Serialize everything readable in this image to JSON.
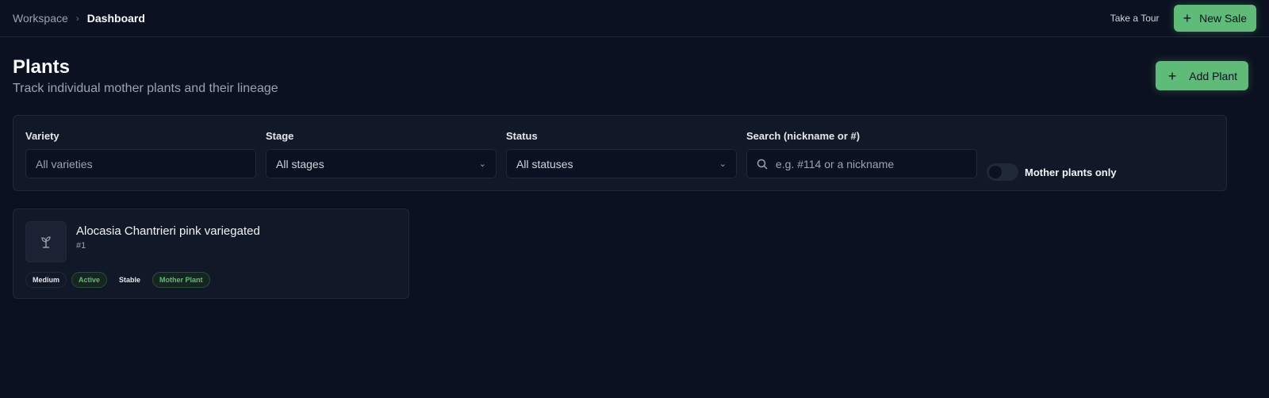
{
  "breadcrumb": {
    "workspace": "Workspace",
    "separator": "›",
    "current": "Dashboard"
  },
  "header": {
    "tour_label": "Take a Tour",
    "new_sale_label": "New Sale"
  },
  "page": {
    "title": "Plants",
    "subtitle": "Track individual mother plants and their lineage",
    "add_label": "Add Plant"
  },
  "filters": {
    "variety": {
      "label": "Variety",
      "placeholder": "All varieties"
    },
    "stage": {
      "label": "Stage",
      "value": "All stages"
    },
    "status": {
      "label": "Status",
      "value": "All statuses"
    },
    "search": {
      "label": "Search (nickname or #)",
      "placeholder": "e.g. #114 or a nickname"
    },
    "mother_toggle": {
      "label": "Mother plants only",
      "on": false
    }
  },
  "plants": [
    {
      "name": "Alocasia Chantrieri pink variegated",
      "number": "#1",
      "badges": [
        "Medium",
        "Active",
        "Stable",
        "Mother Plant"
      ]
    }
  ],
  "colors": {
    "accent": "#5ebc78",
    "background": "#0b1120",
    "panel": "#111827"
  },
  "icons": {
    "plus": "plus-icon",
    "chevron": "chevron-down-icon",
    "search": "search-icon",
    "plant": "sprout-icon"
  }
}
